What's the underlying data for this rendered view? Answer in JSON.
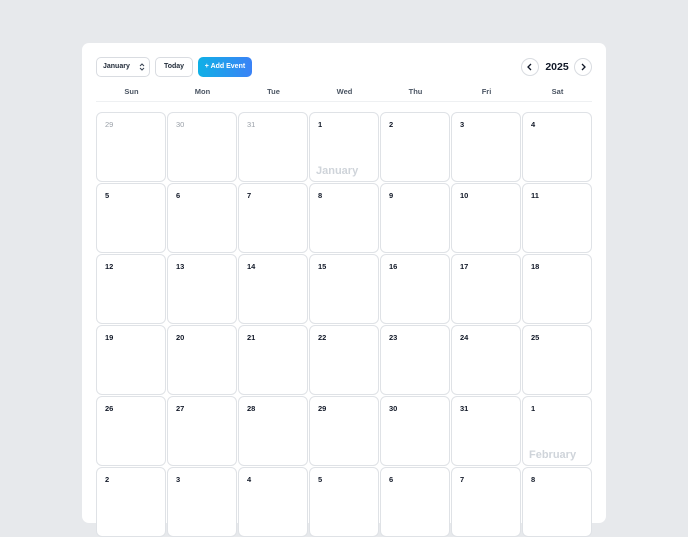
{
  "toolbar": {
    "month_select_value": "January",
    "today_label": "Today",
    "add_event_label": "+ Add Event",
    "year": "2025"
  },
  "weekdays": [
    "Sun",
    "Mon",
    "Tue",
    "Wed",
    "Thu",
    "Fri",
    "Sat"
  ],
  "month_labels": {
    "january": "January",
    "february": "February"
  },
  "weeks": [
    [
      "29",
      "30",
      "31",
      "1",
      "2",
      "3",
      "4"
    ],
    [
      "5",
      "6",
      "7",
      "8",
      "9",
      "10",
      "11"
    ],
    [
      "12",
      "13",
      "14",
      "15",
      "16",
      "17",
      "18"
    ],
    [
      "19",
      "20",
      "21",
      "22",
      "23",
      "24",
      "25"
    ],
    [
      "26",
      "27",
      "28",
      "29",
      "30",
      "31",
      "1"
    ],
    [
      "2",
      "3",
      "4",
      "5",
      "6",
      "7",
      "8"
    ]
  ],
  "colors": {
    "accent_start": "#0fb0e6",
    "accent_end": "#3b82f6",
    "background": "#e7e9ec",
    "muted_text": "#9aa0a8"
  },
  "icons": {
    "month_select": "chevron-updown-icon",
    "prev": "chevron-left-icon",
    "next": "chevron-right-icon"
  }
}
